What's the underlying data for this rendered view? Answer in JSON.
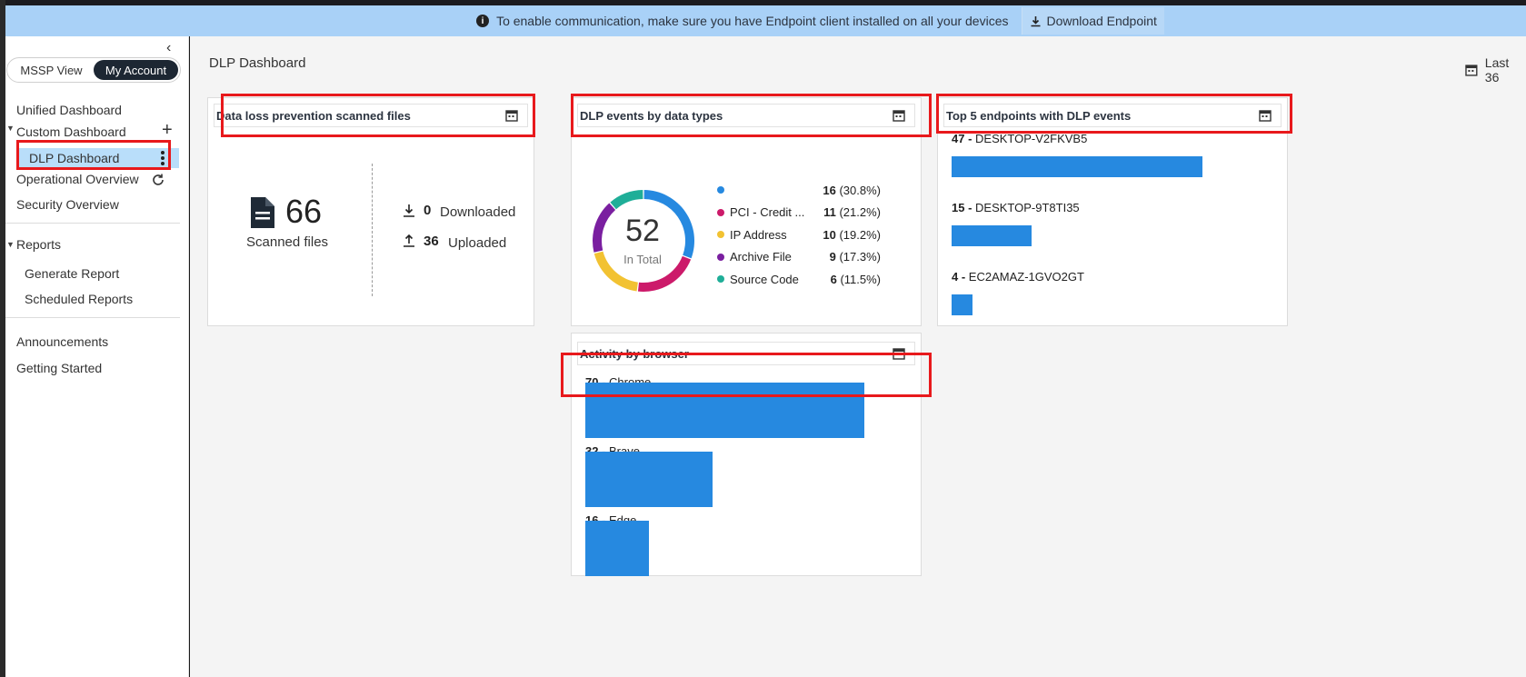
{
  "banner": {
    "message": "To enable communication, make sure you have Endpoint client installed on all your devices",
    "download_label": "Download Endpoint"
  },
  "sidebar": {
    "toggle": {
      "mssp_label": "MSSP View",
      "account_label": "My Account"
    },
    "items": {
      "unified": "Unified Dashboard",
      "custom": "Custom Dashboard",
      "dlp": "DLP Dashboard",
      "operational": "Operational Overview",
      "security": "Security Overview",
      "reports": "Reports",
      "generate": "Generate Report",
      "scheduled": "Scheduled Reports",
      "announcements": "Announcements",
      "getting_started": "Getting Started"
    }
  },
  "header": {
    "title": "DLP Dashboard",
    "date_range": "Last 36"
  },
  "cards": {
    "scanned": {
      "title": "Data loss prevention scanned files",
      "total": "66",
      "total_label": "Scanned files",
      "downloaded_count": "0",
      "downloaded_label": "Downloaded",
      "uploaded_count": "36",
      "uploaded_label": "Uploaded"
    },
    "events": {
      "title": "DLP events by data types",
      "center_value": "52",
      "center_label": "In Total"
    },
    "endpoints": {
      "title": "Top 5 endpoints with DLP events"
    },
    "browser": {
      "title": "Activity by browser"
    }
  },
  "chart_data": [
    {
      "type": "pie",
      "title": "DLP events by data types",
      "categories": [
        "",
        "PCI - Credit ...",
        "IP Address",
        "Archive File",
        "Source Code"
      ],
      "values": [
        16,
        11,
        10,
        9,
        6
      ],
      "percents": [
        "(30.8%)",
        "(21.2%)",
        "(19.2%)",
        "(17.3%)",
        "(11.5%)"
      ],
      "colors": [
        "#2689e0",
        "#cc1a6a",
        "#f2c232",
        "#7a1fa0",
        "#1fae98"
      ],
      "total": 52
    },
    {
      "type": "bar",
      "title": "Top 5 endpoints with DLP events",
      "categories": [
        "DESKTOP-V2FKVB5",
        "DESKTOP-9T8TI35",
        "EC2AMAZ-1GVO2GT"
      ],
      "values": [
        47,
        15,
        4
      ]
    },
    {
      "type": "bar",
      "title": "Activity by browser",
      "categories": [
        "Chrome",
        "Brave",
        "Edge"
      ],
      "values": [
        70,
        32,
        16
      ]
    }
  ]
}
